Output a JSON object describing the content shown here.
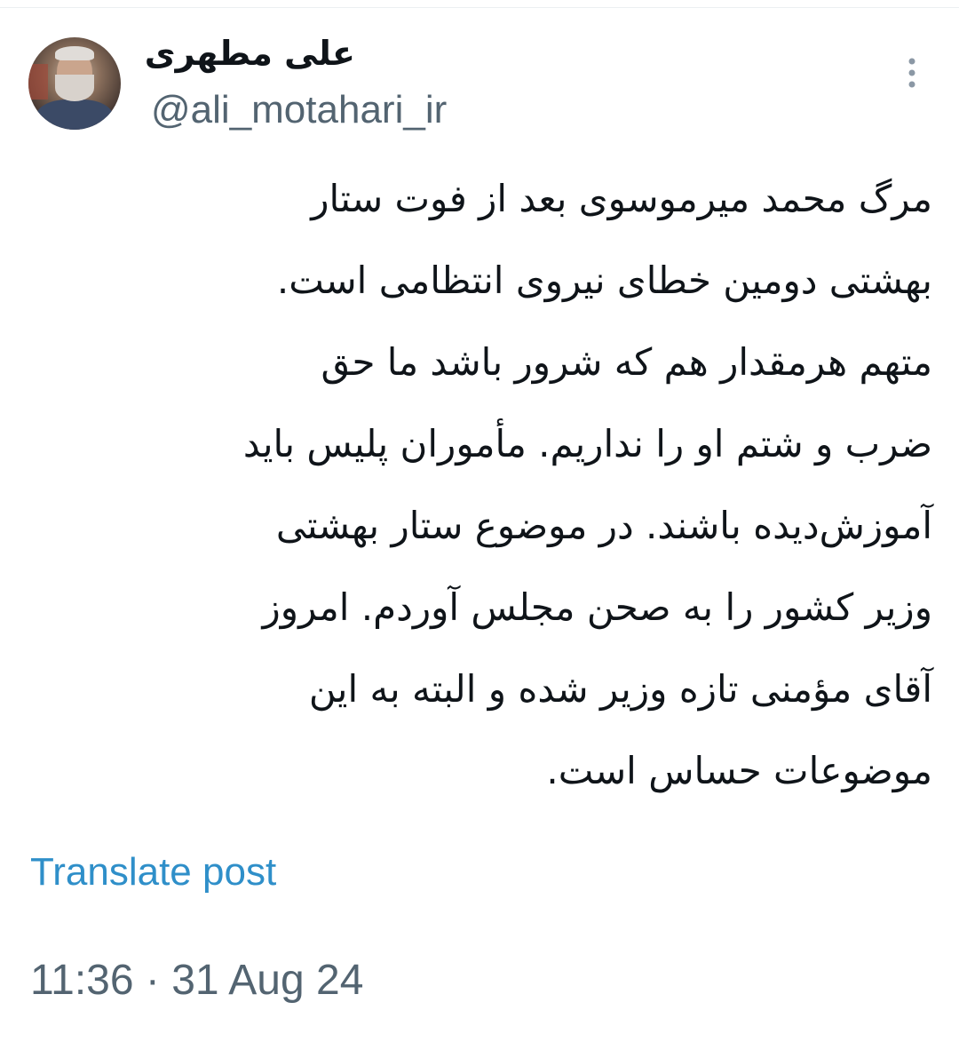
{
  "author": {
    "display_name": "علی مطهری",
    "handle": "@ali_motahari_ir"
  },
  "tweet": {
    "lines": [
      "مرگ محمد میرموسوی بعد از فوت ستار",
      "بهشتی دومین خطای نیروی انتظامی است.",
      "متهم هرمقدار هم که شرور باشد ما حق",
      "ضرب و شتم او را نداریم. مأموران پلیس باید",
      "آموزش‌دیده باشند. در موضوع ستار بهشتی",
      "وزیر کشور را به صحن مجلس آوردم. امروز",
      "آقای مؤمنی تازه وزیر شده و البته به این",
      "موضوعات حساس است."
    ],
    "translate_label": "Translate post",
    "timestamp": "11:36 · 31 Aug 24"
  },
  "icons": {
    "more": "more-vertical-icon",
    "avatar": "profile-avatar"
  },
  "colors": {
    "text": "#0f1419",
    "secondary": "#536471",
    "link": "#2f8fc9",
    "background": "#ffffff"
  }
}
